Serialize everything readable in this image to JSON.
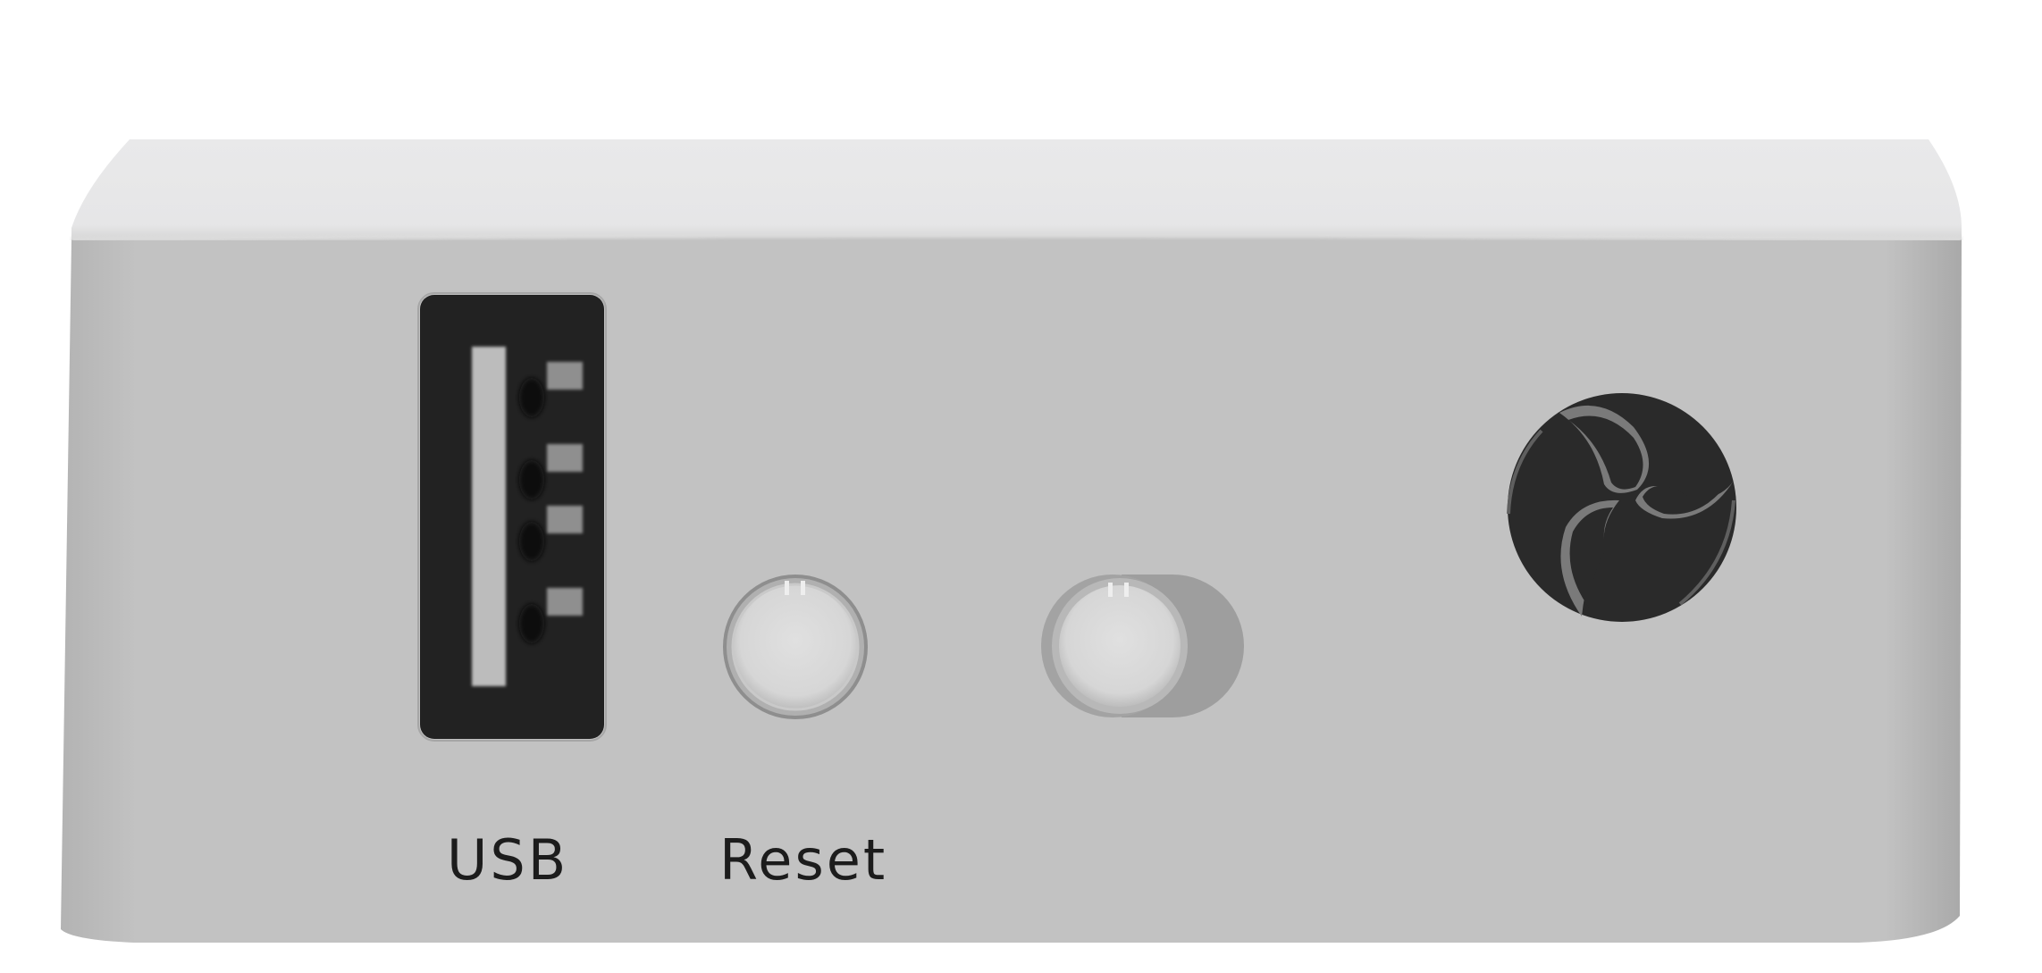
{
  "labels": {
    "usb": "USB",
    "reset": "Reset"
  },
  "controls": {
    "usb_port": {
      "icon": "usb-port-icon"
    },
    "reset_button": {
      "icon": "round-button-icon"
    },
    "power_switch": {
      "icon": "toggle-switch-icon"
    },
    "fan": {
      "icon": "fan-icon"
    }
  },
  "colors": {
    "casing_front": "#c1c1c1",
    "casing_top": "#e8e8e9",
    "port_body": "#222222",
    "button_face": "#d9d9d9",
    "switch_track": "#9e9e9e",
    "fan_dark": "#2a2a2a"
  }
}
